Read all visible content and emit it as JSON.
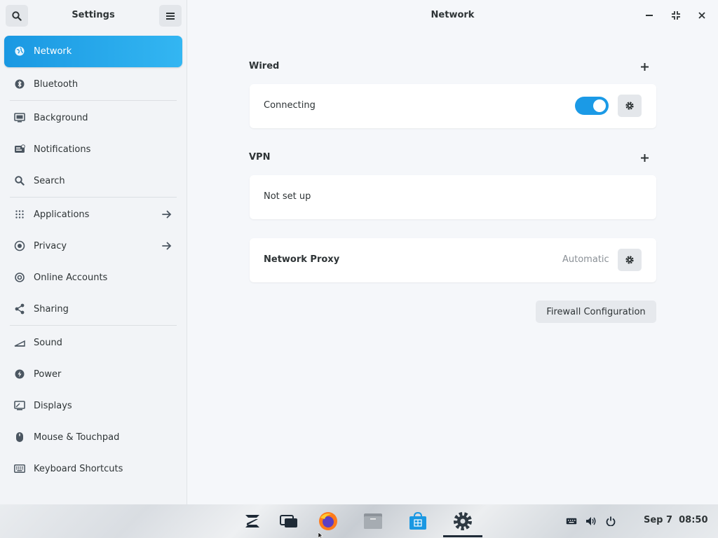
{
  "sidebar": {
    "title": "Settings",
    "search_icon": "search-icon",
    "menu_icon": "hamburger-menu-icon",
    "items": [
      {
        "label": "Network",
        "icon": "globe-icon",
        "active": true
      },
      {
        "label": "Bluetooth",
        "icon": "bluetooth-icon"
      },
      {
        "label": "Background",
        "icon": "background-icon"
      },
      {
        "label": "Notifications",
        "icon": "notifications-icon"
      },
      {
        "label": "Search",
        "icon": "search-icon"
      },
      {
        "label": "Applications",
        "icon": "apps-grid-icon",
        "arrow": true
      },
      {
        "label": "Privacy",
        "icon": "privacy-icon",
        "arrow": true
      },
      {
        "label": "Online Accounts",
        "icon": "at-sign-icon"
      },
      {
        "label": "Sharing",
        "icon": "share-icon"
      },
      {
        "label": "Sound",
        "icon": "sound-icon"
      },
      {
        "label": "Power",
        "icon": "power-bolt-icon"
      },
      {
        "label": "Displays",
        "icon": "display-icon"
      },
      {
        "label": "Mouse & Touchpad",
        "icon": "mouse-icon"
      },
      {
        "label": "Keyboard Shortcuts",
        "icon": "keyboard-icon"
      }
    ]
  },
  "main": {
    "title": "Network",
    "wired": {
      "label": "Wired",
      "status": "Connecting",
      "toggle_on": true
    },
    "vpn": {
      "label": "VPN",
      "status": "Not set up"
    },
    "proxy": {
      "label": "Network Proxy",
      "value": "Automatic"
    },
    "firewall_button": "Firewall Configuration"
  },
  "taskbar": {
    "apps": [
      "zorin-menu-icon",
      "workspace-icon",
      "firefox-icon",
      "files-icon",
      "software-store-icon",
      "settings-gear-icon"
    ],
    "active_app": "settings-gear-icon",
    "tray": [
      "keyboard-layout-icon",
      "volume-icon",
      "power-icon"
    ],
    "date": "Sep 7",
    "time": "08:50"
  },
  "colors": {
    "accent": "#1b9ae6",
    "sidebar_bg": "#f2f4f7",
    "main_bg": "#f5f7fa"
  }
}
